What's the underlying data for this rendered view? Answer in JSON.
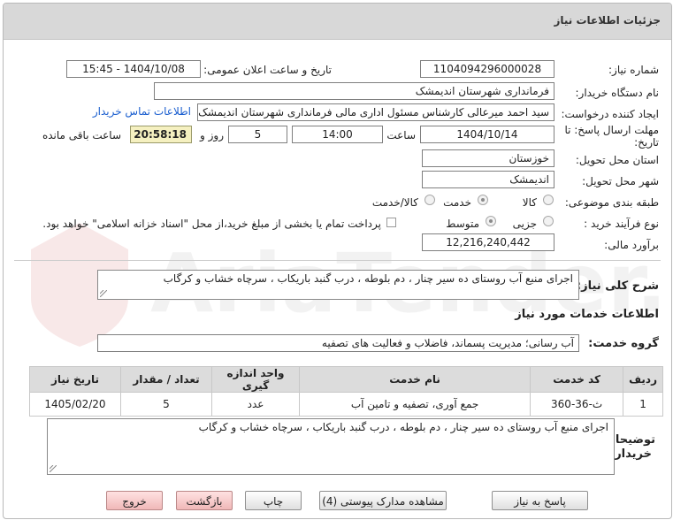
{
  "title": "جزئیات اطلاعات نیاز",
  "watermark": {
    "text": "AriaTender.net"
  },
  "form": {
    "need_number_label": "شماره نیاز:",
    "need_number": "1104094296000028",
    "announce_label": "تاریخ و ساعت اعلان عمومی:",
    "announce_value": "1404/10/08 - 15:45",
    "buyer_org_label": "نام دستگاه خریدار:",
    "buyer_org": "فرمانداری شهرستان اندیمشک",
    "creator_label": "ایجاد کننده درخواست:",
    "creator": "سید احمد میرعالی کارشناس مسئول اداری مالی فرمانداری شهرستان اندیمشک",
    "contact_link": "اطلاعات تماس خریدار",
    "deadline_label_1": "مهلت ارسال پاسخ: تا",
    "deadline_label_2": "تاریخ:",
    "deadline_date": "1404/10/14",
    "time_label": "ساعت",
    "deadline_time": "14:00",
    "days_value": "5",
    "days_label": "روز و",
    "remaining_time": "20:58:18",
    "remaining_label": "ساعت باقی مانده",
    "province_label": "استان محل تحویل:",
    "province": "خوزستان",
    "city_label": "شهر محل تحویل:",
    "city": "اندیمشک",
    "category_label": "طبقه بندی موضوعی:",
    "category_options": [
      "کالا",
      "خدمت",
      "کالا/خدمت"
    ],
    "category_selected": "خدمت",
    "process_label": "نوع فرآیند خرید :",
    "process_options": [
      "جزیی",
      "متوسط"
    ],
    "process_selected": "متوسط",
    "payment_note": "پرداخت تمام یا بخشی از مبلغ خرید،از محل \"اسناد خزانه اسلامی\" خواهد بود.",
    "budget_label": "برآورد مالی:",
    "budget": "12,216,240,442"
  },
  "summary": {
    "label": "شرح کلی نیاز:",
    "text": "اجرای منبع آب روستای  ده سیر چنار ، دم بلوطه ، درب گنبد باریکاب ، سرچاه خشاب و کرگاب"
  },
  "services": {
    "header": "اطلاعات خدمات مورد نیاز",
    "group_label": "گروه خدمت:",
    "group_value": "آب رسانی؛ مدیریت پسماند، فاضلاب و فعالیت های تصفیه",
    "columns": [
      "ردیف",
      "کد خدمت",
      "نام خدمت",
      "واحد اندازه گیری",
      "تعداد / مقدار",
      "تاریخ نیاز"
    ],
    "rows": [
      {
        "idx": "1",
        "code": "ث-36-360",
        "name": "جمع آوری، تصفیه و تامین آب",
        "unit": "عدد",
        "qty": "5",
        "date": "1405/02/20"
      }
    ]
  },
  "buyer_notes": {
    "label_1": "توضیحات",
    "label_2": "خریدار:",
    "text": "اجرای منبع آب روستای  ده سیر چنار ، دم بلوطه ، درب گنبد باریکاب ، سرچاه خشاب و کرگاب"
  },
  "buttons": {
    "reply": "پاسخ به نیاز",
    "attachments": "مشاهده مدارک پیوستی (4)",
    "print": "چاپ",
    "back": "بازگشت",
    "exit": "خروج"
  }
}
